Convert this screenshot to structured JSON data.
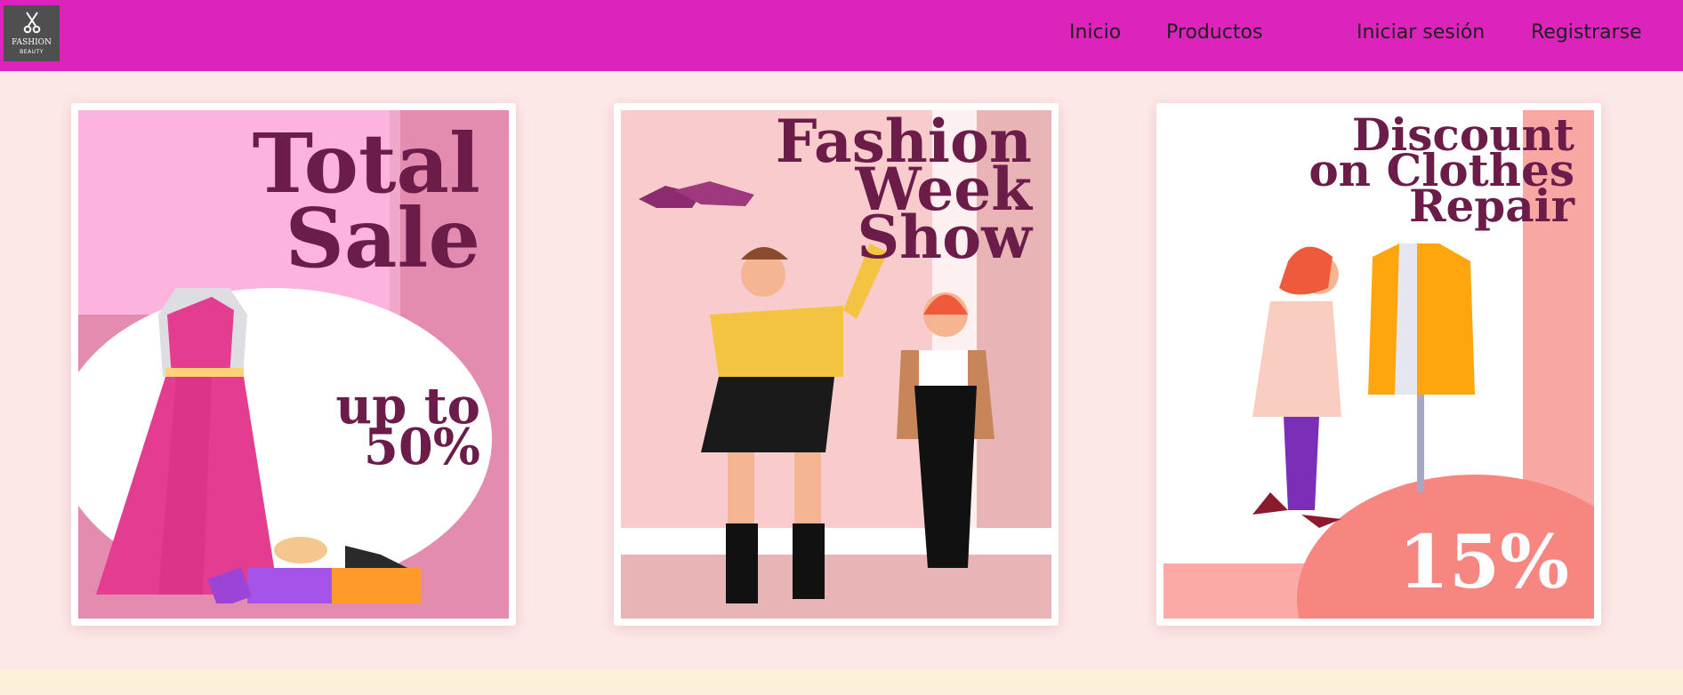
{
  "brand": {
    "line1": "FASHION",
    "line2": "BEAUTY",
    "icon": "scissors-icon"
  },
  "nav": {
    "home": "Inicio",
    "products": "Productos",
    "login": "Iniciar sesión",
    "register": "Registrarse"
  },
  "cards": [
    {
      "title": "Total\nSale",
      "subtitle": "up to\n50%"
    },
    {
      "title": "Fashion\nWeek\nShow"
    },
    {
      "title": "Discount\non Clothes\nRepair",
      "badge": "15%"
    }
  ],
  "colors": {
    "navbar": "#dc24bd",
    "page_background": "#fde8e8",
    "title_text": "#6b1c48",
    "footer_strip": "#fdf0d9"
  }
}
